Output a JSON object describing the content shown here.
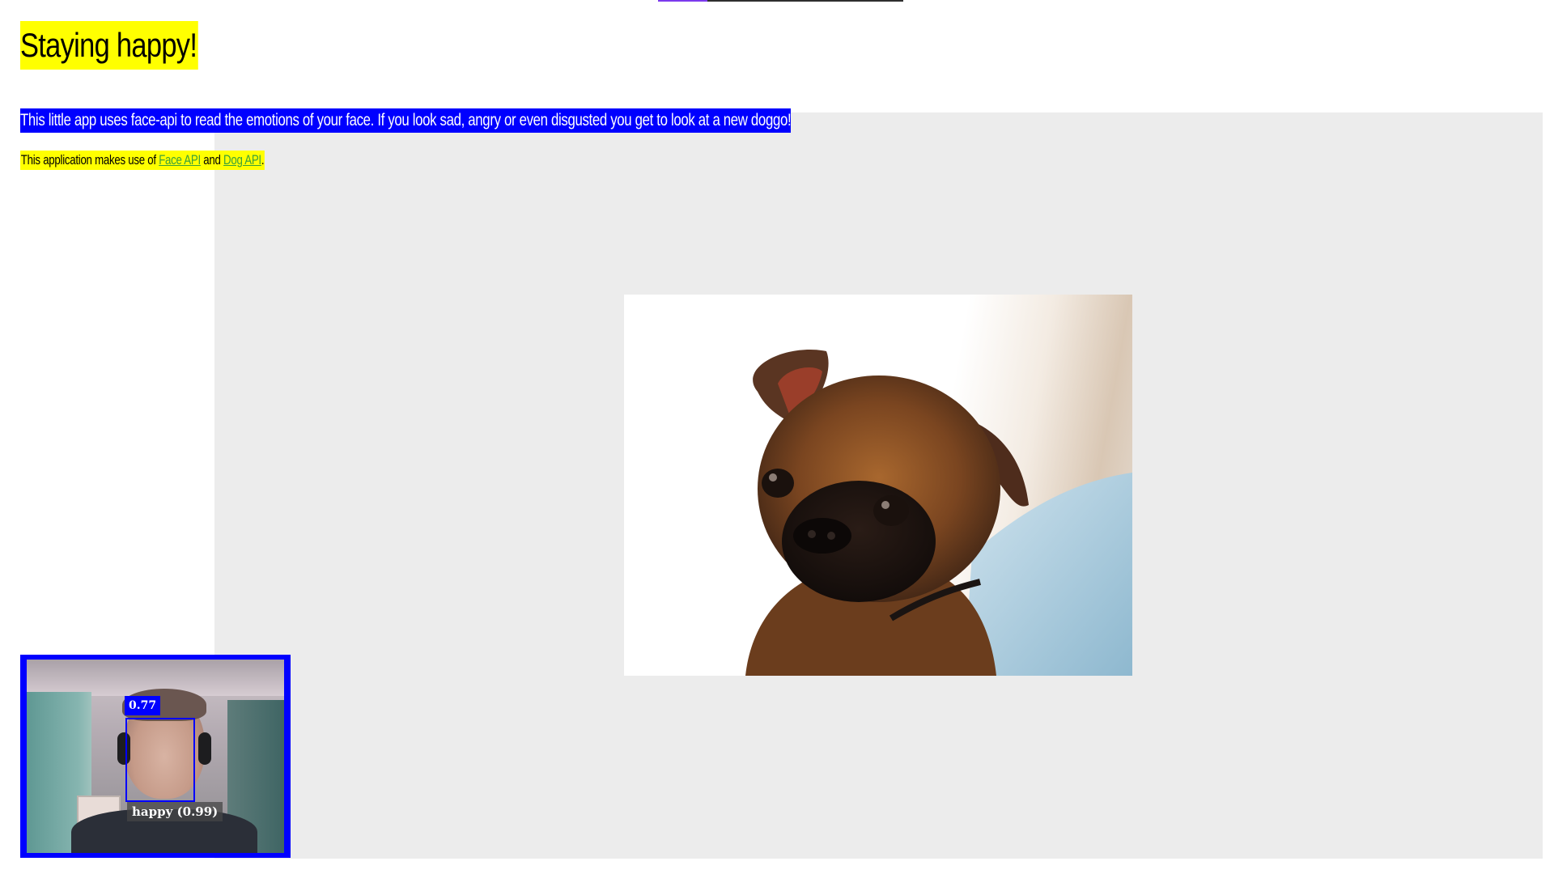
{
  "header": {
    "title": "Staying happy!"
  },
  "intro": {
    "text": "This little app uses face-api to read the emotions of your face. If you look sad, angry or even disgusted you get to look at a new doggo!"
  },
  "credits": {
    "prefix": "This application makes use of ",
    "link1_label": "Face API",
    "middle": " and ",
    "link2_label": "Dog API",
    "suffix": "."
  },
  "loading_bar": {
    "progress": 0.2
  },
  "webcam": {
    "detection_score": "0.77",
    "emotion_label": "happy (0.99)"
  },
  "colors": {
    "highlight_yellow": "#ffff00",
    "accent_blue": "#0000ff",
    "stage_gray": "#ececec",
    "link_green": "#3aa03a"
  }
}
